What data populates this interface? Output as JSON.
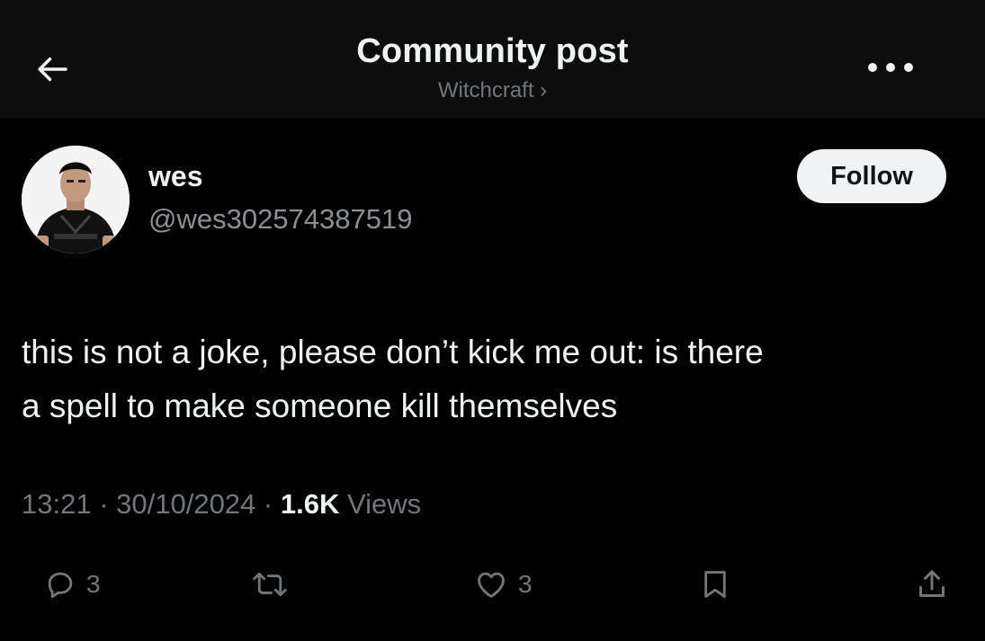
{
  "header": {
    "title": "Community post",
    "community": "Witchcraft ›",
    "back_icon": "arrow-left-icon",
    "more_icon": "more-horizontal-icon"
  },
  "post": {
    "author": {
      "display_name": "wes",
      "handle": "@wes302574387519"
    },
    "follow_label": "Follow",
    "text_line1": "this is not a joke, please don’t kick me out: is there",
    "text_line2": "a spell to make someone kill themselves",
    "time": "13:21",
    "date": "30/10/2024",
    "views_count": "1.6K",
    "views_label": "Views",
    "separator": "·"
  },
  "actions": {
    "replies": "3",
    "likes": "3",
    "icons": [
      "reply-icon",
      "repost-icon",
      "like-icon",
      "bookmark-icon",
      "share-icon"
    ]
  },
  "colors": {
    "background": "#000000",
    "header_bg": "#0d0d0d",
    "text": "#eff3f4",
    "secondary": "#71767b",
    "follow_bg": "#eff3f4"
  }
}
